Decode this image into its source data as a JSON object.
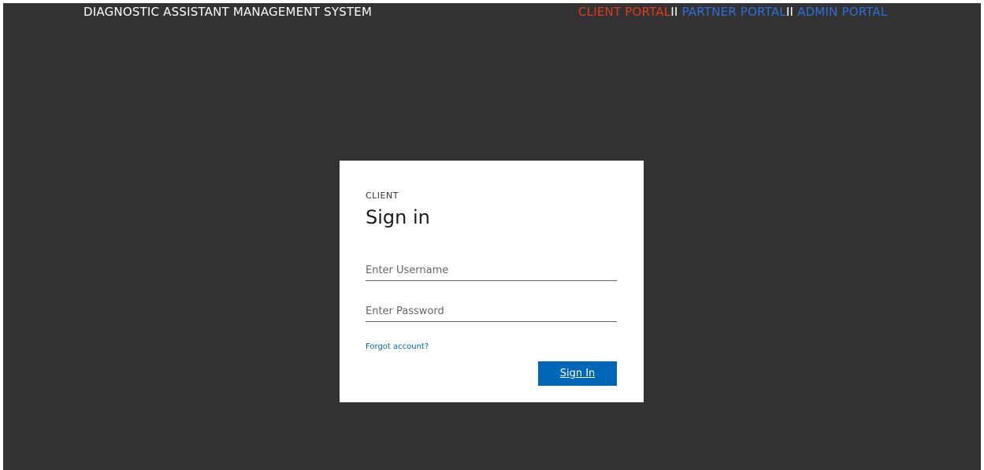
{
  "header": {
    "app_title": "DIAGNOSTIC ASSISTANT MANAGEMENT SYSTEM",
    "portals": [
      {
        "label": "CLIENT PORTAL",
        "color": "#e03c1f"
      },
      {
        "label": "PARTNER PORTAL",
        "color": "#2e6fd8"
      },
      {
        "label": "ADMIN PORTAL",
        "color": "#2e6fd8"
      }
    ],
    "separator": "II"
  },
  "signin": {
    "eyebrow": "CLIENT",
    "heading": "Sign in",
    "username_placeholder": "Enter Username",
    "username_value": "",
    "password_placeholder": "Enter Password",
    "password_value": "",
    "forgot_label": "Forgot account?",
    "button_label": "Sign In"
  },
  "colors": {
    "background": "#333333",
    "card": "#ffffff",
    "accent": "#0067b8"
  }
}
